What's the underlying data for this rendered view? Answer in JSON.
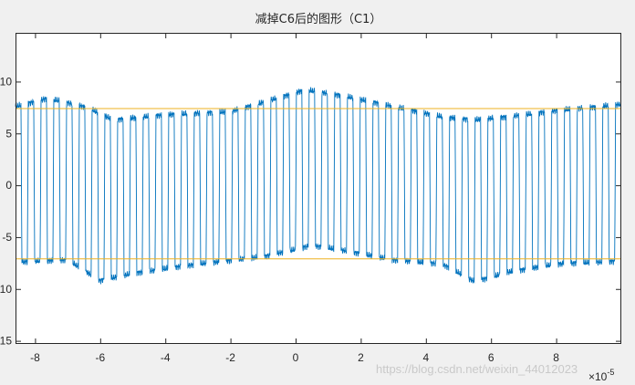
{
  "chart_data": {
    "type": "line",
    "title": "减掉C6后的图形（C1）",
    "xlabel": "",
    "ylabel": "",
    "x_exponent_label": "×10",
    "x_exponent_power": "-5",
    "xlim": [
      -8.6,
      10.0
    ],
    "ylim": [
      -15.3,
      14.7
    ],
    "x_ticks": [
      -8,
      -6,
      -4,
      -2,
      0,
      2,
      4,
      6,
      8
    ],
    "x_tick_labels": [
      "-8",
      "-6",
      "-4",
      "-2",
      "0",
      "2",
      "4",
      "6",
      "8"
    ],
    "y_ticks": [
      -15,
      -10,
      -5,
      0,
      5,
      10
    ],
    "y_tick_labels": [
      "15",
      "10",
      "-5",
      "0",
      "5",
      "10"
    ],
    "grid": false,
    "series": [
      {
        "color": "#0072bd",
        "signal": {
          "kind": "square_wave",
          "period": 0.392,
          "duty": 0.5,
          "edge_fraction": 0.07,
          "high_level_points": [
            [
              -8.6,
              7.6
            ],
            [
              -7.6,
              8.4
            ],
            [
              -6.4,
              7.5
            ],
            [
              -5.6,
              6.3
            ],
            [
              -4.0,
              6.8
            ],
            [
              -2.0,
              7.1
            ],
            [
              -1.0,
              8.0
            ],
            [
              0.3,
              9.2
            ],
            [
              1.5,
              8.6
            ],
            [
              3.0,
              7.6
            ],
            [
              4.5,
              6.6
            ],
            [
              5.5,
              6.3
            ],
            [
              6.5,
              6.6
            ],
            [
              8.0,
              7.2
            ],
            [
              10.0,
              7.8
            ]
          ],
          "low_level_points": [
            [
              -8.6,
              -7.4
            ],
            [
              -7.0,
              -7.2
            ],
            [
              -6.0,
              -9.2
            ],
            [
              -5.0,
              -8.5
            ],
            [
              -3.0,
              -7.6
            ],
            [
              -1.0,
              -6.9
            ],
            [
              0.5,
              -5.8
            ],
            [
              1.5,
              -6.3
            ],
            [
              3.0,
              -7.2
            ],
            [
              4.5,
              -7.6
            ],
            [
              5.5,
              -9.3
            ],
            [
              6.5,
              -8.4
            ],
            [
              8.0,
              -7.6
            ],
            [
              10.0,
              -7.3
            ]
          ]
        }
      },
      {
        "color": "#edb120",
        "y": 7.4
      },
      {
        "color": "#edb120",
        "y": -7.1
      }
    ]
  },
  "watermark": "https://blog.csdn.net/weixin_44012023"
}
